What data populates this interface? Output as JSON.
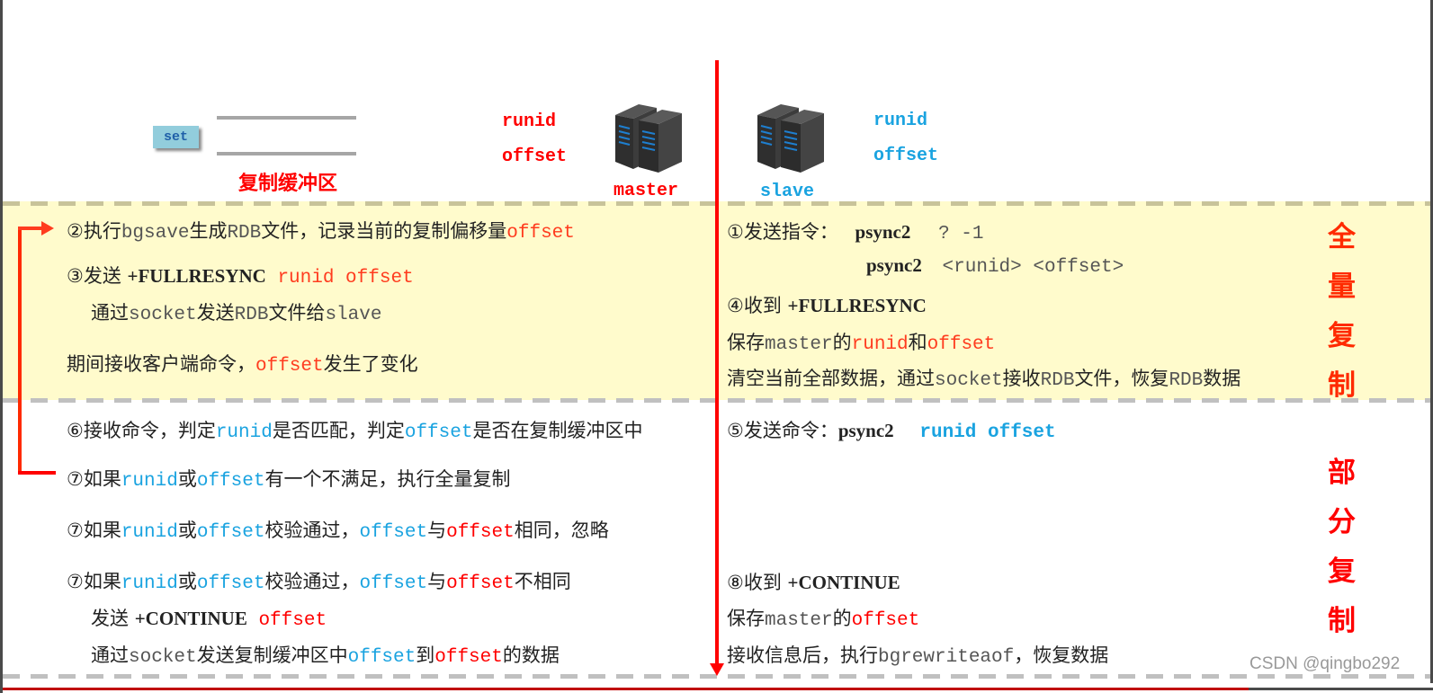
{
  "header": {
    "set_label": "set",
    "buffer_label": "复制缓冲区",
    "master": {
      "runid": "runid",
      "offset": "offset",
      "name": "master"
    },
    "slave": {
      "runid": "runid",
      "offset": "offset",
      "name": "slave"
    }
  },
  "sections": {
    "full_sync_label": [
      "全",
      "量",
      "复",
      "制"
    ],
    "partial_sync_label": [
      "部",
      "分",
      "复",
      "制"
    ]
  },
  "master_steps": {
    "s2": {
      "prefix": "②执行",
      "cmd": "bgsave",
      "mid": "生成",
      "rdb": "RDB",
      "suffix": "文件，记录当前的复制偏移量",
      "offset": "offset"
    },
    "s3": {
      "prefix": "③发送 ",
      "cmd": "+FULLRESYNC",
      "args": " runid offset"
    },
    "s3b": {
      "prefix": "通过",
      "socket": "socket",
      "mid": "发送",
      "rdb": "RDB",
      "suffix": "文件给",
      "slave": "slave"
    },
    "s3c": {
      "prefix": "期间接收客户端命令，",
      "offset": "offset",
      "suffix": "发生了变化"
    },
    "s6": {
      "prefix": "⑥接收命令，判定",
      "runid": "runid",
      "mid": "是否匹配，判定",
      "offset": "offset",
      "suffix": "是否在复制缓冲区中"
    },
    "s7a": {
      "prefix": "⑦如果",
      "runid": "runid",
      "or": "或",
      "offset": "offset",
      "suffix": "有一个不满足，执行全量复制"
    },
    "s7b": {
      "prefix": "⑦如果",
      "runid": "runid",
      "or": "或",
      "offset": "offset",
      "mid": "校验通过，",
      "offset1": "offset",
      "with": "与",
      "offset2": "offset",
      "suffix": "相同，忽略"
    },
    "s7c": {
      "prefix": "⑦如果",
      "runid": "runid",
      "or": "或",
      "offset": "offset",
      "mid": "校验通过，",
      "offset1": "offset",
      "with": "与",
      "offset2": "offset",
      "suffix": "不相同"
    },
    "s7d": {
      "prefix": "发送 ",
      "cmd": "+CONTINUE",
      "offset": " offset"
    },
    "s7e": {
      "prefix": "通过",
      "socket": "socket",
      "mid": "发送复制缓冲区中",
      "offset1": "offset",
      "to": "到",
      "offset2": "offset",
      "suffix": "的数据"
    }
  },
  "slave_steps": {
    "s1": {
      "prefix": "①发送指令：",
      "cmd": "psync2",
      "args": "? -1"
    },
    "s1b": {
      "cmd": "psync2",
      "args": "<runid> <offset>"
    },
    "s4": {
      "prefix": "④收到 ",
      "cmd": "+FULLRESYNC"
    },
    "s4b": {
      "prefix": "保存",
      "master": "master",
      "of": "的",
      "runid": "runid",
      "and": "和",
      "offset": "offset"
    },
    "s4c": {
      "prefix": "清空当前全部数据，通过",
      "socket": "socket",
      "mid": "接收",
      "rdb": "RDB",
      "mid2": "文件，恢复",
      "rdb2": "RDB",
      "suffix": "数据"
    },
    "s5": {
      "prefix": "⑤发送命令：",
      "cmd": "psync2",
      "args": "runid offset"
    },
    "s8": {
      "prefix": "⑧收到 ",
      "cmd": "+CONTINUE"
    },
    "s8b": {
      "prefix": "保存",
      "master": "master",
      "of": "的",
      "offset": "offset"
    },
    "s8c": {
      "prefix": "接收信息后，执行",
      "cmd": "bgrewriteaof",
      "suffix": "，恢复数据"
    }
  },
  "watermark": "CSDN @qingbo292",
  "colors": {
    "master": "#ff0000",
    "slave": "#1aa3e0",
    "band": "#fffbcc",
    "divider": "#ff0000"
  }
}
